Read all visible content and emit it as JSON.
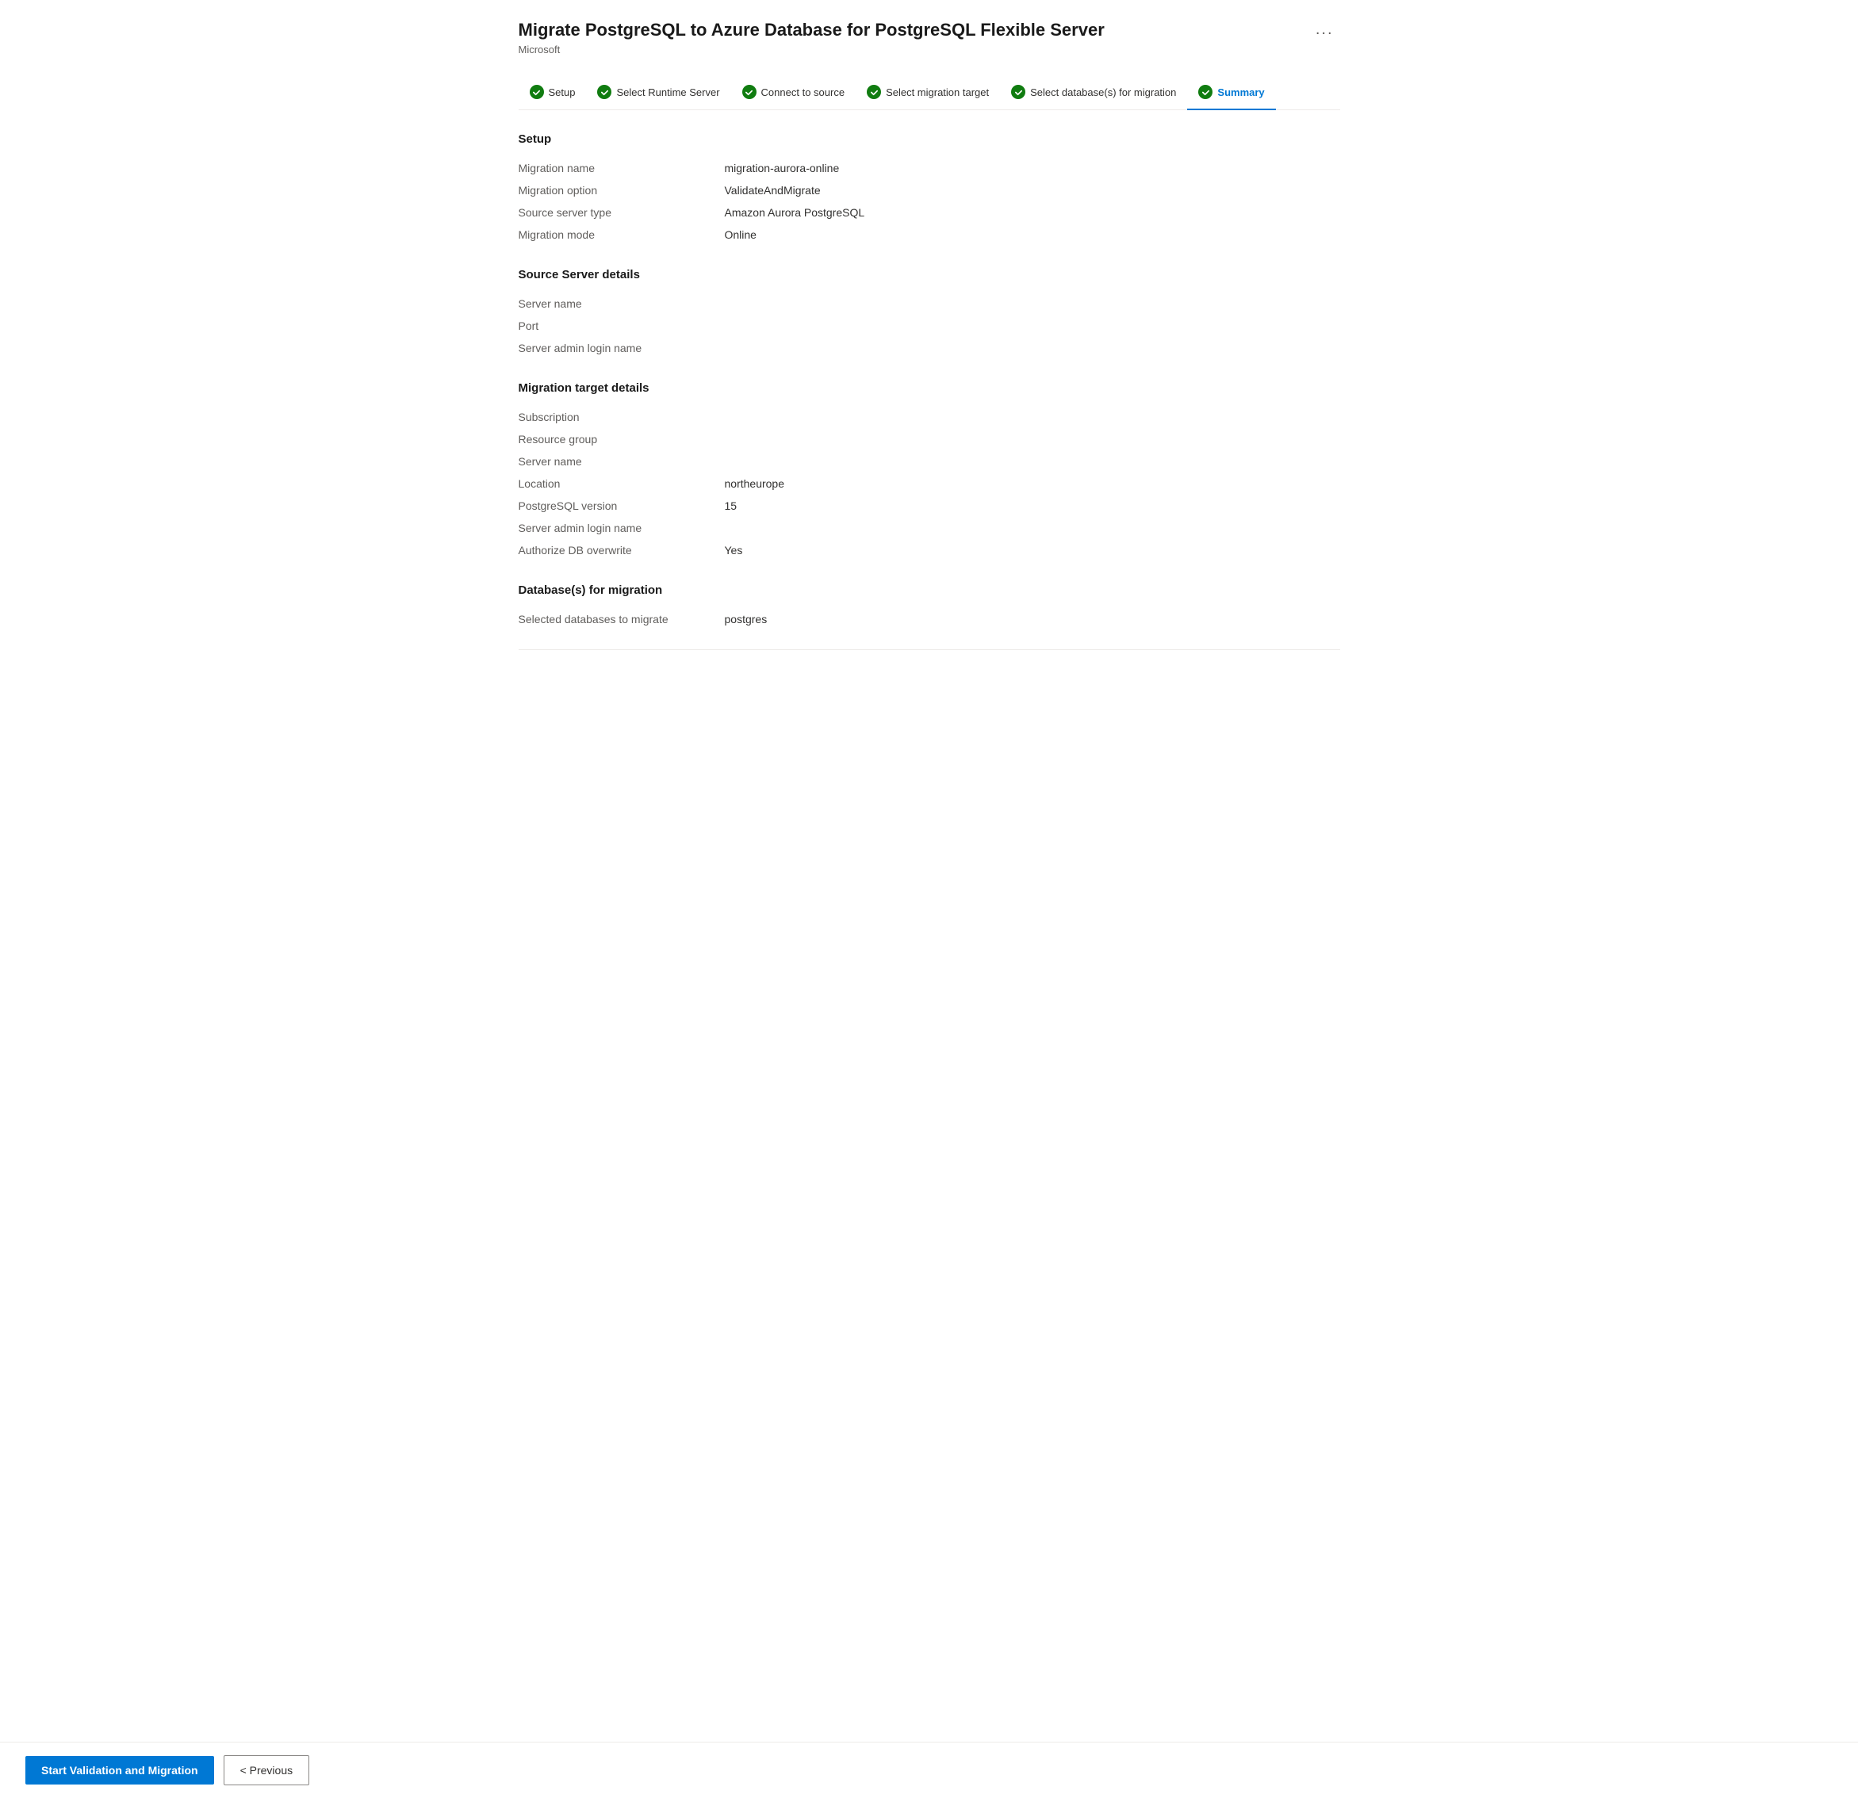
{
  "header": {
    "title": "Migrate PostgreSQL to Azure Database for PostgreSQL Flexible Server",
    "subtitle": "Microsoft",
    "ellipsis": "..."
  },
  "steps": [
    {
      "id": "setup",
      "label": "Setup",
      "completed": true,
      "active": false
    },
    {
      "id": "runtime-server",
      "label": "Select Runtime Server",
      "completed": true,
      "active": false
    },
    {
      "id": "connect-source",
      "label": "Connect to source",
      "completed": true,
      "active": false
    },
    {
      "id": "migration-target",
      "label": "Select migration target",
      "completed": true,
      "active": false
    },
    {
      "id": "select-databases",
      "label": "Select database(s) for migration",
      "completed": true,
      "active": false
    },
    {
      "id": "summary",
      "label": "Summary",
      "completed": true,
      "active": true
    }
  ],
  "sections": {
    "setup": {
      "title": "Setup",
      "fields": [
        {
          "label": "Migration name",
          "value": "migration-aurora-online"
        },
        {
          "label": "Migration option",
          "value": "ValidateAndMigrate"
        },
        {
          "label": "Source server type",
          "value": "Amazon Aurora PostgreSQL"
        },
        {
          "label": "Migration mode",
          "value": "Online"
        }
      ]
    },
    "source": {
      "title": "Source Server details",
      "fields": [
        {
          "label": "Server name",
          "value": ""
        },
        {
          "label": "Port",
          "value": ""
        },
        {
          "label": "Server admin login name",
          "value": ""
        }
      ]
    },
    "target": {
      "title": "Migration target details",
      "fields": [
        {
          "label": "Subscription",
          "value": ""
        },
        {
          "label": "Resource group",
          "value": ""
        },
        {
          "label": "Server name",
          "value": ""
        },
        {
          "label": "Location",
          "value": "northeurope"
        },
        {
          "label": "PostgreSQL version",
          "value": "15"
        },
        {
          "label": "Server admin login name",
          "value": ""
        },
        {
          "label": "Authorize DB overwrite",
          "value": "Yes"
        }
      ]
    },
    "databases": {
      "title": "Database(s) for migration",
      "fields": [
        {
          "label": "Selected databases to migrate",
          "value": "postgres"
        }
      ]
    }
  },
  "footer": {
    "start_button": "Start Validation and Migration",
    "previous_button": "< Previous"
  }
}
